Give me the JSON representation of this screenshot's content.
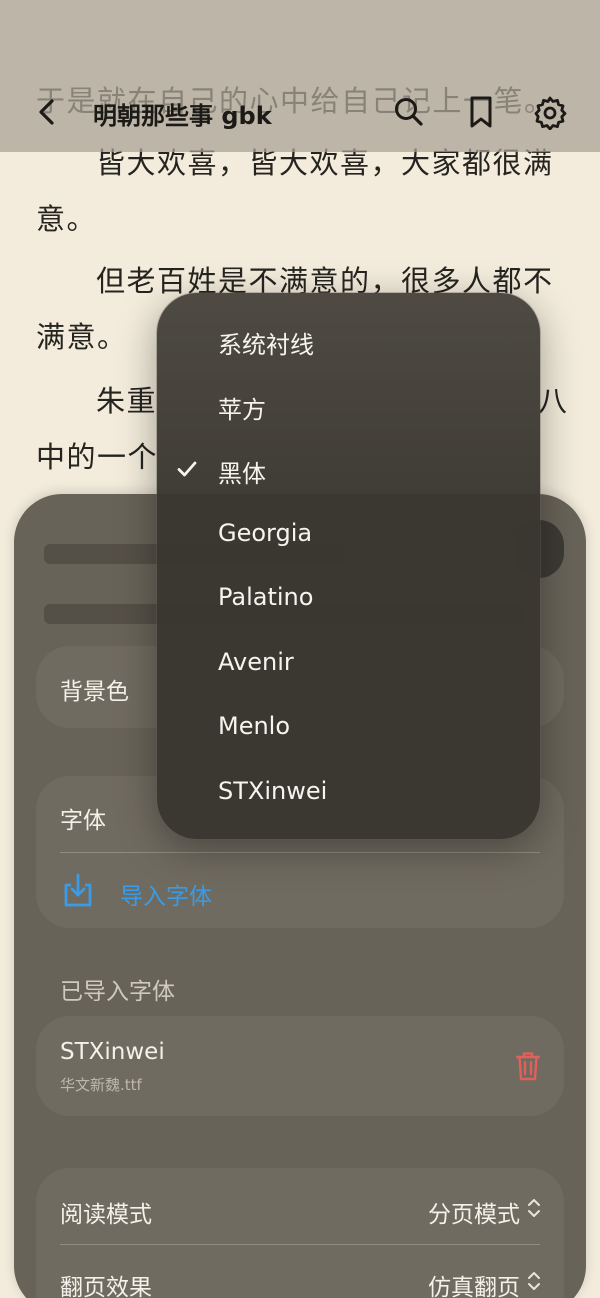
{
  "reader": {
    "lines": [
      "皆大欢喜，皆大欢喜，大家都很满",
      "意。",
      "但老百姓是不满意的，很多人都不",
      "满意。",
      "朱重",
      "八",
      "中的一个"
    ],
    "ghost_line": "于是就在自己的心中给自己记上一笔。"
  },
  "nav": {
    "title": "明朝那些事 gbk",
    "icons": [
      "back-icon",
      "search-icon",
      "bookmark-icon",
      "gear-icon"
    ]
  },
  "panel": {
    "background_label": "背景色",
    "font_label": "字体",
    "import_font_label": "导入字体",
    "imported_section_label": "已导入字体",
    "imported_font": {
      "name": "STXinwei",
      "file": "华文新魏.ttf"
    },
    "reading_mode_label": "阅读模式",
    "reading_mode_value": "分页模式",
    "page_turn_label": "翻页效果",
    "page_turn_value": "仿真翻页"
  },
  "dropdown": {
    "options": [
      "系统衬线",
      "苹方",
      "黑体",
      "Georgia",
      "Palatino",
      "Avenir",
      "Menlo",
      "STXinwei"
    ],
    "selected": "黑体"
  },
  "colors": {
    "accent": "#3a9be6",
    "delete": "#e0605a",
    "paper": "#f3ecdc"
  }
}
